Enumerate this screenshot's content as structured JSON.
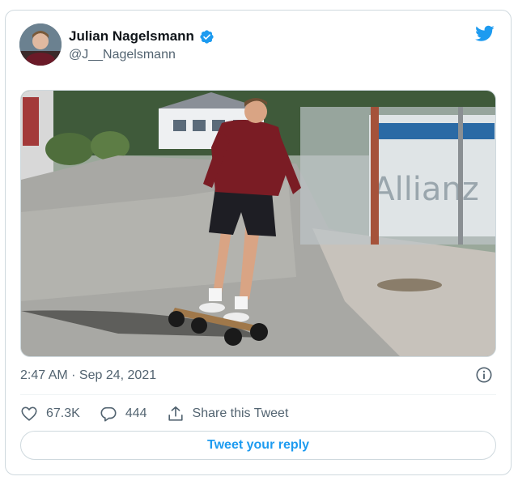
{
  "tweet": {
    "author_name": "Julian Nagelsmann",
    "author_handle": "@J__Nagelsmann",
    "verified": true,
    "timestamp": "2:47 AM · Sep 24, 2021",
    "image": {
      "sign_text": "Allianz"
    }
  },
  "actions": {
    "likes": "67.3K",
    "replies": "444",
    "share_label": "Share this Tweet"
  },
  "reply_button_label": "Tweet your reply",
  "colors": {
    "brand_blue": "#1d9bf0",
    "text_secondary": "#536471",
    "border": "#cfd9de"
  },
  "icons": [
    "twitter-logo-icon",
    "verified-badge-icon",
    "info-icon",
    "heart-icon",
    "reply-icon",
    "share-icon"
  ]
}
